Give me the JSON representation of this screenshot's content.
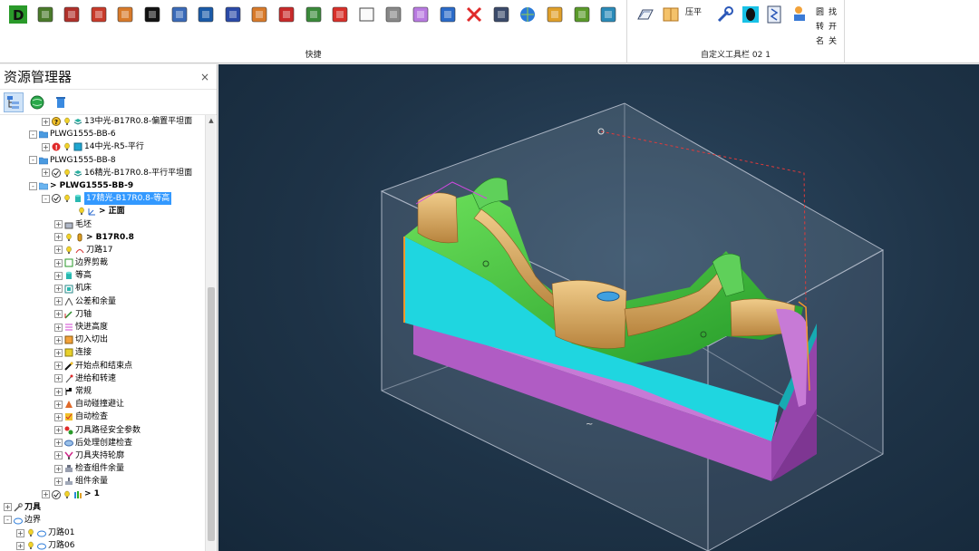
{
  "ribbon": {
    "groups": [
      {
        "label": "快捷"
      },
      {
        "label": "自定义工具栏 02 1"
      }
    ],
    "custom_texts": [
      "压平",
      "圆",
      "找",
      "转",
      "开",
      "名",
      "关"
    ],
    "quick_icons": [
      "d-icon",
      "bucket-icon",
      "needle-icon",
      "cube-red-icon",
      "cube-orange-icon",
      "silhouette-icon",
      "people-icon",
      "penguin-icon",
      "tag-icon",
      "chart-icon",
      "target-icon",
      "grid-icon",
      "toolpath-icon",
      "box-icon",
      "panda-icon",
      "cube-icon",
      "transfer-icon",
      "close-icon",
      "arrows-icon",
      "globe-icon",
      "battery-icon",
      "component-icon",
      "box-check-icon"
    ]
  },
  "explorer": {
    "title": "资源管理器",
    "close": "×",
    "tree": [
      {
        "indent": 3,
        "toggle": "+",
        "icons": [
          "question",
          "bulb",
          "layers"
        ],
        "label": "13中光-B17R0.8-偏置平坦面"
      },
      {
        "indent": 2,
        "toggle": "-",
        "icons": [
          "folder"
        ],
        "label": "PLWG1555-BB-6"
      },
      {
        "indent": 3,
        "toggle": "+",
        "icons": [
          "warning",
          "bulb",
          "square"
        ],
        "label": "14中光-R5-平行"
      },
      {
        "indent": 2,
        "toggle": "-",
        "icons": [
          "folder"
        ],
        "label": "PLWG1555-BB-8"
      },
      {
        "indent": 3,
        "toggle": "+",
        "icons": [
          "check",
          "bulb",
          "layers"
        ],
        "label": "16精光-B17R0.8-平行平坦面"
      },
      {
        "indent": 2,
        "toggle": "-",
        "icons": [
          "folder-open"
        ],
        "label": "> PLWG1555-BB-9",
        "bold": true
      },
      {
        "indent": 3,
        "toggle": "-",
        "icons": [
          "check",
          "bulb",
          "cylinder"
        ],
        "label": "17精光-B17R0.8-等高",
        "selected": true
      },
      {
        "indent": 5,
        "toggle": "",
        "icons": [
          "bulb",
          "axis"
        ],
        "label": "> 正面",
        "bold": true
      },
      {
        "indent": 4,
        "toggle": "+",
        "icons": [
          "block"
        ],
        "label": "毛坯"
      },
      {
        "indent": 4,
        "toggle": "+",
        "icons": [
          "bulb",
          "tool"
        ],
        "label": "> B17R0.8",
        "bold": true
      },
      {
        "indent": 4,
        "toggle": "+",
        "icons": [
          "bulb",
          "path"
        ],
        "label": "刀路17"
      },
      {
        "indent": 4,
        "toggle": "+",
        "icons": [
          "boundary"
        ],
        "label": "边界剪裁"
      },
      {
        "indent": 4,
        "toggle": "+",
        "icons": [
          "cylinder"
        ],
        "label": "等高"
      },
      {
        "indent": 4,
        "toggle": "+",
        "icons": [
          "machine"
        ],
        "label": "机床"
      },
      {
        "indent": 4,
        "toggle": "+",
        "icons": [
          "tolerance"
        ],
        "label": "公差和余量"
      },
      {
        "indent": 4,
        "toggle": "+",
        "icons": [
          "axis2"
        ],
        "label": "刀轴"
      },
      {
        "indent": 4,
        "toggle": "+",
        "icons": [
          "rapid"
        ],
        "label": "快进高度"
      },
      {
        "indent": 4,
        "toggle": "+",
        "icons": [
          "leadin"
        ],
        "label": "切入切出"
      },
      {
        "indent": 4,
        "toggle": "+",
        "icons": [
          "link"
        ],
        "label": "连接"
      },
      {
        "indent": 4,
        "toggle": "+",
        "icons": [
          "startend"
        ],
        "label": "开始点和结束点"
      },
      {
        "indent": 4,
        "toggle": "+",
        "icons": [
          "feed"
        ],
        "label": "进给和转速"
      },
      {
        "indent": 4,
        "toggle": "+",
        "icons": [
          "flag"
        ],
        "label": "常规"
      },
      {
        "indent": 4,
        "toggle": "+",
        "icons": [
          "collision"
        ],
        "label": "自动碰撞避让"
      },
      {
        "indent": 4,
        "toggle": "+",
        "icons": [
          "autocheck"
        ],
        "label": "自动检查"
      },
      {
        "indent": 4,
        "toggle": "+",
        "icons": [
          "safety"
        ],
        "label": "刀具路径安全参数"
      },
      {
        "indent": 4,
        "toggle": "+",
        "icons": [
          "post"
        ],
        "label": "后处理创建检查"
      },
      {
        "indent": 4,
        "toggle": "+",
        "icons": [
          "holder"
        ],
        "label": "刀具夹持轮廓"
      },
      {
        "indent": 4,
        "toggle": "+",
        "icons": [
          "stock"
        ],
        "label": "检查组件余量"
      },
      {
        "indent": 4,
        "toggle": "+",
        "icons": [
          "stock2"
        ],
        "label": "组件余量"
      },
      {
        "indent": 3,
        "toggle": "+",
        "icons": [
          "check",
          "bulb",
          "books"
        ],
        "label": "> 1",
        "bold": true
      },
      {
        "indent": 0,
        "toggle": "+",
        "icons": [
          "tools"
        ],
        "label": "刀具",
        "bold": true
      },
      {
        "indent": 0,
        "toggle": "-",
        "icons": [
          "cloud"
        ],
        "label": "边界"
      },
      {
        "indent": 1,
        "toggle": "+",
        "icons": [
          "bulb",
          "cloud"
        ],
        "label": "刀路01"
      },
      {
        "indent": 1,
        "toggle": "+",
        "icons": [
          "bulb",
          "cloud"
        ],
        "label": "刀路06"
      }
    ]
  },
  "colors": {
    "selection": "#3399ff",
    "stock_outline": "#a9b3c2",
    "part_cyan": "#1fd6e0",
    "part_magenta": "#b05cc4",
    "part_green": "#3fc23f",
    "part_tan": "#d8a860",
    "dashed": "#e23a3a"
  }
}
